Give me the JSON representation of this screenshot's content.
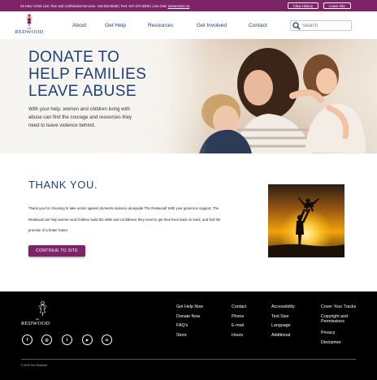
{
  "topbar": {
    "crisis_text_prefix": "24 Hour Crisis Line, free and confidential services. 416.533.0538 | Text: 647.270.8306 | Live chat: ",
    "crisis_link": "iamwomine.ca",
    "clear_history": "Clear History",
    "leave_site": "Leave Site",
    "color": "#7d2367"
  },
  "logo": {
    "the": "the",
    "word": "REDWOOD"
  },
  "nav": {
    "items": [
      "About",
      "Get Help",
      "Resources",
      "Get Involved",
      "Contact"
    ]
  },
  "search": {
    "placeholder": "Search"
  },
  "hero": {
    "title_line1": "DONATE TO",
    "title_line2": "HELP FAMILIES",
    "title_line3": "LEAVE ABUSE",
    "text": "With your help, women and children living with abuse can find the courage and resources they need to leave violence behind."
  },
  "thanks": {
    "title": "THANK YOU.",
    "text": "Thank you for choosing to take action against domestic violence alongside The Redwood! With your generous support, The Redwood can help women and children build the skills and confidence they need to get their lives back on track, and find the promise of a better future.",
    "button": "CONTINUE TO SITE"
  },
  "footer": {
    "logo_the": "the",
    "logo_word": "REDWOOD",
    "social": [
      {
        "icon": "facebook-icon",
        "glyph": "f"
      },
      {
        "icon": "instagram-icon",
        "glyph": "◎"
      },
      {
        "icon": "twitter-icon",
        "glyph": "t"
      },
      {
        "icon": "youtube-icon",
        "glyph": "▶"
      },
      {
        "icon": "linkedin-icon",
        "glyph": "in"
      }
    ],
    "col1": [
      "Get Help Now",
      "Donate Now",
      "FAQ's",
      "Store"
    ],
    "col2": [
      "Contact",
      "Phone",
      "E-mail",
      "Hours"
    ],
    "col3": [
      "Accessibility",
      "Text Size",
      "Language",
      "Additional"
    ],
    "col4": [
      "Cover Your Tracks",
      "Copyright and Permissions",
      "Privacy",
      "Disclaimer"
    ],
    "copyright": "© 2020 The Redwood"
  },
  "colors": {
    "brand": "#7d2367",
    "navy": "#1f3f77"
  }
}
